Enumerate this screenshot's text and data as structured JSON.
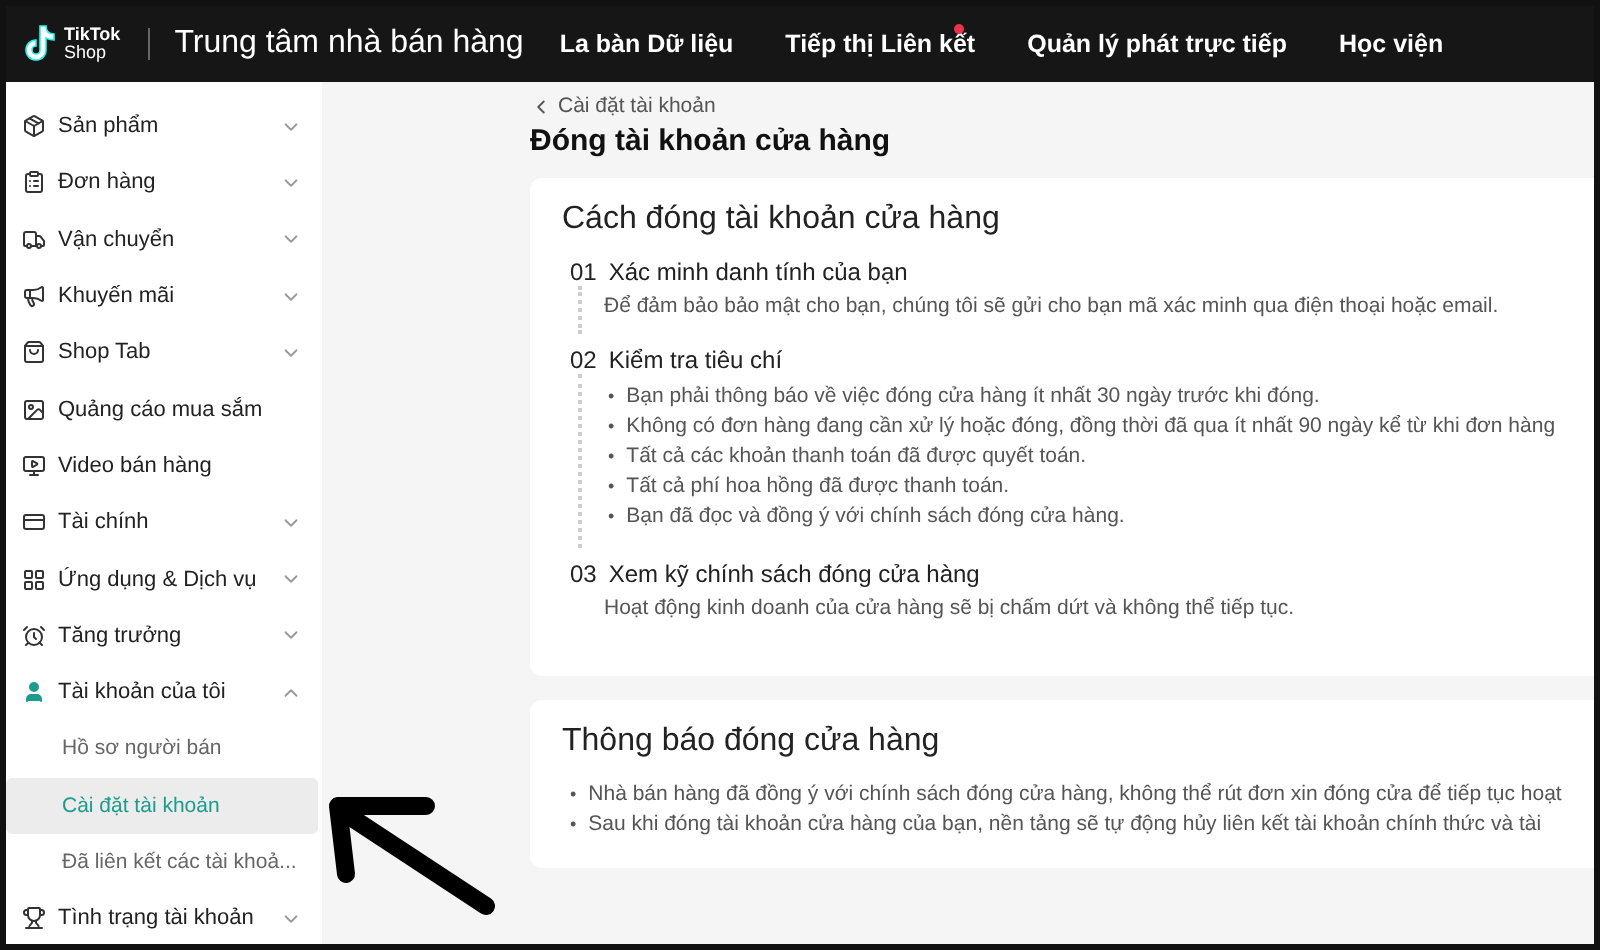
{
  "header": {
    "logo": {
      "line1": "TikTok",
      "line2": "Shop"
    },
    "title": "Trung tâm nhà bán hàng",
    "nav": [
      {
        "label": "La bàn Dữ liệu",
        "dot": false
      },
      {
        "label": "Tiếp thị Liên kết",
        "dot": true
      },
      {
        "label": "Quản lý phát trực tiếp",
        "dot": false
      },
      {
        "label": "Học viện",
        "dot": false
      }
    ]
  },
  "sidebar": {
    "items": [
      {
        "label": "Sản phẩm",
        "kind": "group",
        "expanded": false
      },
      {
        "label": "Đơn hàng",
        "kind": "group",
        "expanded": false
      },
      {
        "label": "Vận chuyển",
        "kind": "group",
        "expanded": false
      },
      {
        "label": "Khuyến mãi",
        "kind": "group",
        "expanded": false
      },
      {
        "label": "Shop Tab",
        "kind": "group",
        "expanded": false
      },
      {
        "label": "Quảng cáo mua sắm",
        "kind": "link"
      },
      {
        "label": "Video bán hàng",
        "kind": "link"
      },
      {
        "label": "Tài chính",
        "kind": "group",
        "expanded": false
      },
      {
        "label": "Ứng dụng & Dịch vụ",
        "kind": "group",
        "expanded": false
      },
      {
        "label": "Tăng trưởng",
        "kind": "group",
        "expanded": false
      },
      {
        "label": "Tài khoản của tôi",
        "kind": "group",
        "expanded": true,
        "children": [
          {
            "label": "Hồ sơ người bán",
            "selected": false
          },
          {
            "label": "Cài đặt tài khoản",
            "selected": true
          },
          {
            "label": "Đã liên kết các tài khoả...",
            "selected": false
          }
        ]
      },
      {
        "label": "Tình trạng tài khoản",
        "kind": "group",
        "expanded": false
      }
    ]
  },
  "breadcrumb": "Cài đặt tài khoản",
  "page_title": "Đóng tài khoản cửa hàng",
  "steps_card": {
    "title": "Cách đóng tài khoản cửa hàng",
    "steps": [
      {
        "number": "01",
        "title": "Xác minh danh tính của bạn",
        "kind": "text",
        "text": "Để đảm bảo bảo mật cho bạn, chúng tôi sẽ gửi cho bạn mã xác minh qua điện thoại hoặc email."
      },
      {
        "number": "02",
        "title": "Kiểm tra tiêu chí",
        "kind": "bullets",
        "marker": "•",
        "bullets": [
          "Bạn phải thông báo về việc đóng cửa hàng ít nhất 30 ngày trước khi đóng.",
          "Không có đơn hàng đang cần xử lý hoặc đóng, đồng thời đã qua ít nhất 90 ngày kể từ khi đơn hàng",
          "Tất cả các khoản thanh toán đã được quyết toán.",
          "Tất cả phí hoa hồng đã được thanh toán.",
          "Bạn đã đọc và đồng ý với chính sách đóng cửa hàng."
        ]
      },
      {
        "number": "03",
        "title": "Xem kỹ chính sách đóng cửa hàng",
        "kind": "text",
        "text": "Hoạt động kinh doanh của cửa hàng sẽ bị chấm dứt và không thể tiếp tục."
      }
    ]
  },
  "notice_card": {
    "title": "Thông báo đóng cửa hàng",
    "marker": "•",
    "bullets": [
      "Nhà bán hàng đã đồng ý với chính sách đóng cửa hàng, không thể rút đơn xin đóng cửa để tiếp tục hoạt",
      "Sau khi đóng tài khoản cửa hàng của bạn, nền tảng sẽ tự động hủy liên kết tài khoản chính thức và tài"
    ]
  }
}
